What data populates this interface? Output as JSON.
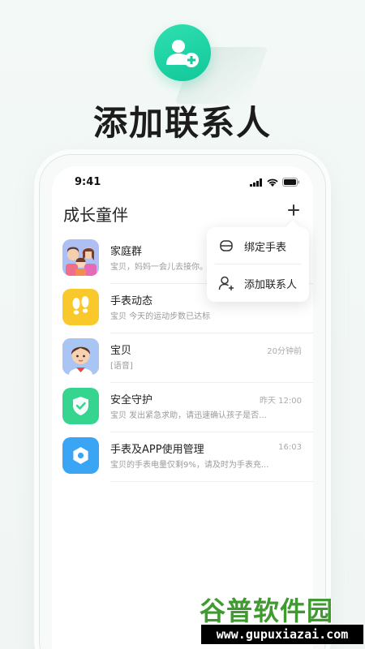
{
  "hero": {
    "title": "添加联系人"
  },
  "status_bar": {
    "time": "9:41"
  },
  "app": {
    "title": "成长童伴"
  },
  "conversations": [
    {
      "name": "家庭群",
      "preview": "宝贝，妈妈一会儿去接你。",
      "time": "",
      "avatar": "family-group-avatar"
    },
    {
      "name": "手表动态",
      "preview": "宝贝 今天的运动步数已达标",
      "time": "",
      "avatar": "footprints-icon"
    },
    {
      "name": "宝贝",
      "preview": "[语音]",
      "time": "20分钟前",
      "avatar": "child-avatar"
    },
    {
      "name": "安全守护",
      "preview": "宝贝 发出紧急求助，请迅速确认孩子是否...",
      "time": "昨天 12:00",
      "avatar": "shield-icon"
    },
    {
      "name": "手表及APP使用管理",
      "preview": "宝贝的手表电量仅剩9%，请及时为手表充...",
      "time": "16:03",
      "avatar": "settings-gear-icon"
    }
  ],
  "popup_menu": {
    "items": [
      {
        "label": "绑定手表",
        "icon": "watch-link-icon"
      },
      {
        "label": "添加联系人",
        "icon": "add-contact-icon"
      }
    ]
  },
  "watermark": {
    "brand": "谷普软件园",
    "url": "www.gupuxiazai.com"
  },
  "colors": {
    "accent": "#17cfa0",
    "yellow": "#f9c82b",
    "blue": "#3aa4f5",
    "green": "#35d48f"
  }
}
